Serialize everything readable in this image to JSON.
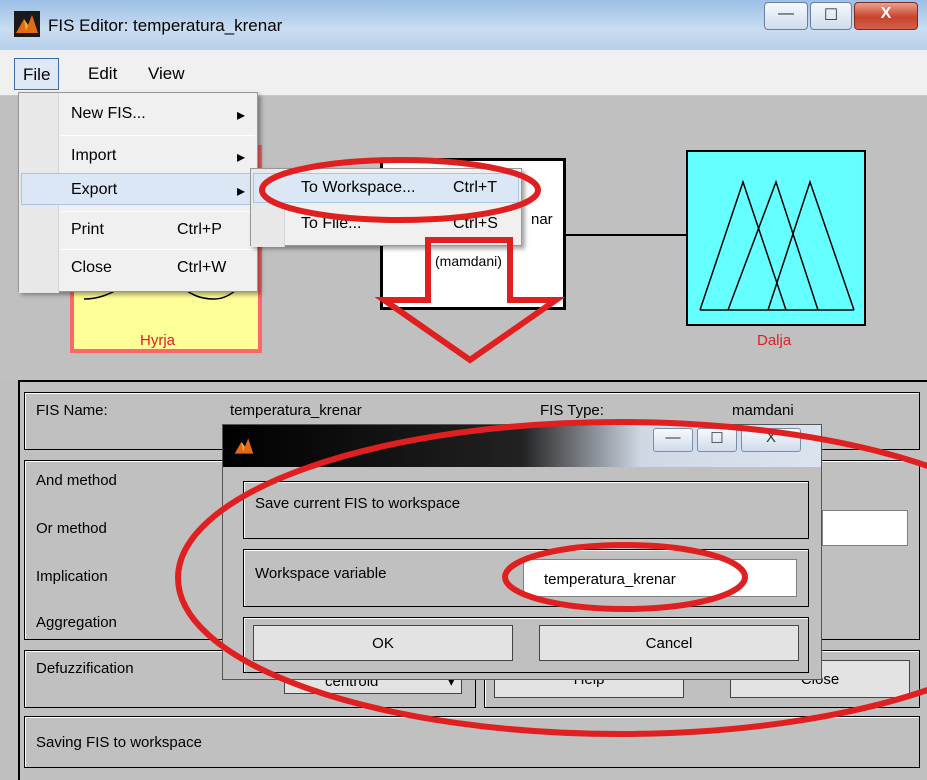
{
  "window": {
    "title": "FIS Editor: temperatura_krenar",
    "min": "—",
    "max": "☐",
    "close": "X"
  },
  "menubar": {
    "file": "File",
    "edit": "Edit",
    "view": "View"
  },
  "file_menu": {
    "new_fis": "New FIS...",
    "import": "Import",
    "export": "Export",
    "print": "Print",
    "print_sc": "Ctrl+P",
    "close": "Close",
    "close_sc": "Ctrl+W"
  },
  "export_menu": {
    "to_workspace": "To Workspace...",
    "to_workspace_sc": "Ctrl+T",
    "to_file": "To File...",
    "to_file_sc": "Ctrl+S"
  },
  "diagram": {
    "input_label": "Hyrja",
    "output_label": "Dalja",
    "system_name_partial": "nar",
    "system_type": "(mamdani)"
  },
  "fis_info": {
    "name_label": "FIS Name:",
    "name_value": "temperatura_krenar",
    "type_label": "FIS Type:",
    "type_value": "mamdani"
  },
  "methods": {
    "and": "And method",
    "or": "Or method",
    "implication": "Implication",
    "aggregation": "Aggregation",
    "defuzz": "Defuzzification",
    "defuzz_value": "centroid"
  },
  "buttons": {
    "help": "Help",
    "close": "Close"
  },
  "status": "Saving FIS to workspace",
  "dialog": {
    "message": "Save current FIS to workspace",
    "var_label": "Workspace variable",
    "var_value": "temperatura_krenar",
    "ok": "OK",
    "cancel": "Cancel"
  },
  "colors": {
    "annotation": "#e02020",
    "input_fill": "#ffff99",
    "output_fill": "#66ffff"
  }
}
